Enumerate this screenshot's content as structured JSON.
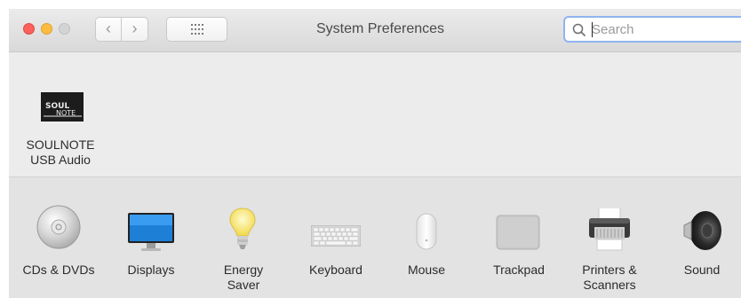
{
  "window": {
    "title": "System Preferences",
    "search": {
      "placeholder": "Search",
      "value": ""
    }
  },
  "third_party": [
    {
      "label": "SOULNOTE\nUSB Audio",
      "icon": "soulnote-icon"
    }
  ],
  "hardware": [
    {
      "label": "CDs & DVDs",
      "icon": "cd-dvd-icon"
    },
    {
      "label": "Displays",
      "icon": "display-icon"
    },
    {
      "label": "Energy\nSaver",
      "icon": "lightbulb-icon"
    },
    {
      "label": "Keyboard",
      "icon": "keyboard-icon"
    },
    {
      "label": "Mouse",
      "icon": "mouse-icon"
    },
    {
      "label": "Trackpad",
      "icon": "trackpad-icon"
    },
    {
      "label": "Printers &\nScanners",
      "icon": "printer-icon"
    },
    {
      "label": "Sound",
      "icon": "speaker-icon"
    }
  ],
  "soulnote_logo_text": "SOUL NOTE"
}
